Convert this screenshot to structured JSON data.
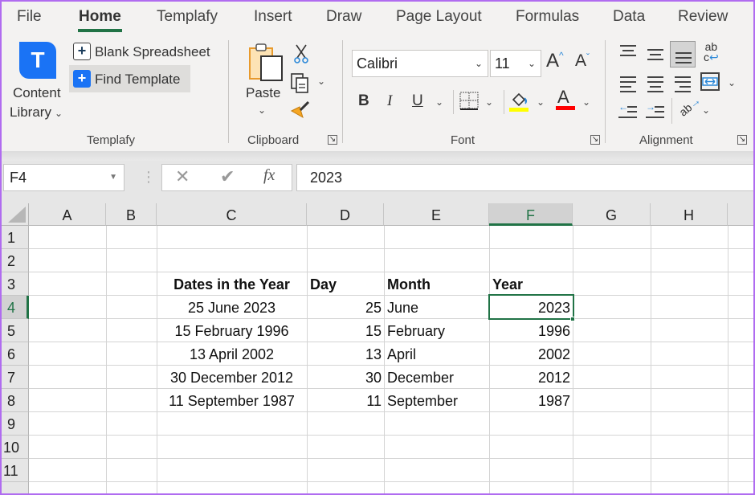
{
  "ribbon_tabs": [
    {
      "label": "File",
      "active": false
    },
    {
      "label": "Home",
      "active": true
    },
    {
      "label": "Templafy",
      "active": false
    },
    {
      "label": "Insert",
      "active": false
    },
    {
      "label": "Draw",
      "active": false
    },
    {
      "label": "Page Layout",
      "active": false
    },
    {
      "label": "Formulas",
      "active": false
    },
    {
      "label": "Data",
      "active": false
    },
    {
      "label": "Review",
      "active": false
    }
  ],
  "templafy": {
    "logo_letter": "T",
    "content_library_line1": "Content",
    "content_library_line2": "Library",
    "blank_spreadsheet": "Blank Spreadsheet",
    "find_template": "Find Template",
    "group_label": "Templafy"
  },
  "clipboard": {
    "paste": "Paste",
    "group_label": "Clipboard"
  },
  "font": {
    "font_name": "Calibri",
    "font_size": "11",
    "bold": "B",
    "italic": "I",
    "underline": "U",
    "highlight_color": "#ffff00",
    "font_color": "#ff0000",
    "group_label": "Font"
  },
  "alignment": {
    "group_label": "Alignment"
  },
  "formula_bar": {
    "name_box": "F4",
    "formula_value": "2023",
    "fx_label": "fx"
  },
  "sheet": {
    "columns": [
      "A",
      "B",
      "C",
      "D",
      "E",
      "F",
      "G",
      "H"
    ],
    "selected_column": "F",
    "rows": [
      "1",
      "2",
      "3",
      "4",
      "5",
      "6",
      "7",
      "8",
      "9",
      "10",
      "11"
    ],
    "selected_row": "4",
    "selected_cell": "F4",
    "headers": {
      "dates": "Dates in the Year",
      "day": "Day",
      "month": "Month",
      "year": "Year"
    },
    "records": [
      {
        "date": "25 June 2023",
        "day": "25",
        "month": "June",
        "year": "2023"
      },
      {
        "date": "15 February 1996",
        "day": "15",
        "month": "February",
        "year": "1996"
      },
      {
        "date": "13 April 2002",
        "day": "13",
        "month": "April",
        "year": "2002"
      },
      {
        "date": "30 December 2012",
        "day": "30",
        "month": "December",
        "year": "2012"
      },
      {
        "date": "11 September 1987",
        "day": "11",
        "month": "September",
        "year": "1987"
      }
    ]
  },
  "colors": {
    "accent": "#217346",
    "templafy_blue": "#1a73f5"
  }
}
